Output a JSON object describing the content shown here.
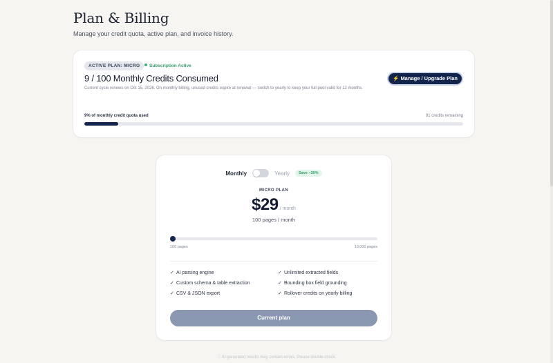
{
  "header": {
    "title": "Plan & Billing",
    "subtitle": "Manage your credit quota, active plan, and invoice history."
  },
  "status": {
    "plan_badge": "ACTIVE PLAN: MICRO",
    "subscription_status": "Subscription Active",
    "credits_title": "9 / 100 Monthly Credits Consumed",
    "renew_note": "Current cycle renews on Oct 15, 2026. On monthly billing, unused credits expire at renewal — switch to yearly to keep your full pool valid for 12 months.",
    "manage_button": "⚡ Manage / Upgrade Plan",
    "quota_label": "9% of monthly credit quota used",
    "remaining": "91 credits remaining",
    "quota_used_fraction": 0.09
  },
  "pricing": {
    "toggle_monthly": "Monthly",
    "toggle_yearly": "Yearly",
    "save_badge": "Save ~20%",
    "plan_name": "MICRO PLAN",
    "price": "$29",
    "per": "/ month",
    "pages_per_month": "100 pages / month",
    "slider_min": "100 pages",
    "slider_max": "10,000 pages",
    "slider_fraction": 0.0,
    "features": [
      "AI parsing engine",
      "Unlimited extracted fields",
      "Custom schema & table extraction",
      "Bounding box field grounding",
      "CSV & JSON export",
      "Rollover credits on yearly billing"
    ],
    "cta": "Current plan"
  },
  "footer": {
    "note": "ⓘ AI-generated results may contain errors. Please double-check."
  },
  "colors": {
    "accent": "#14254d",
    "success": "#2f9e68",
    "background": "#f6f5f2"
  }
}
